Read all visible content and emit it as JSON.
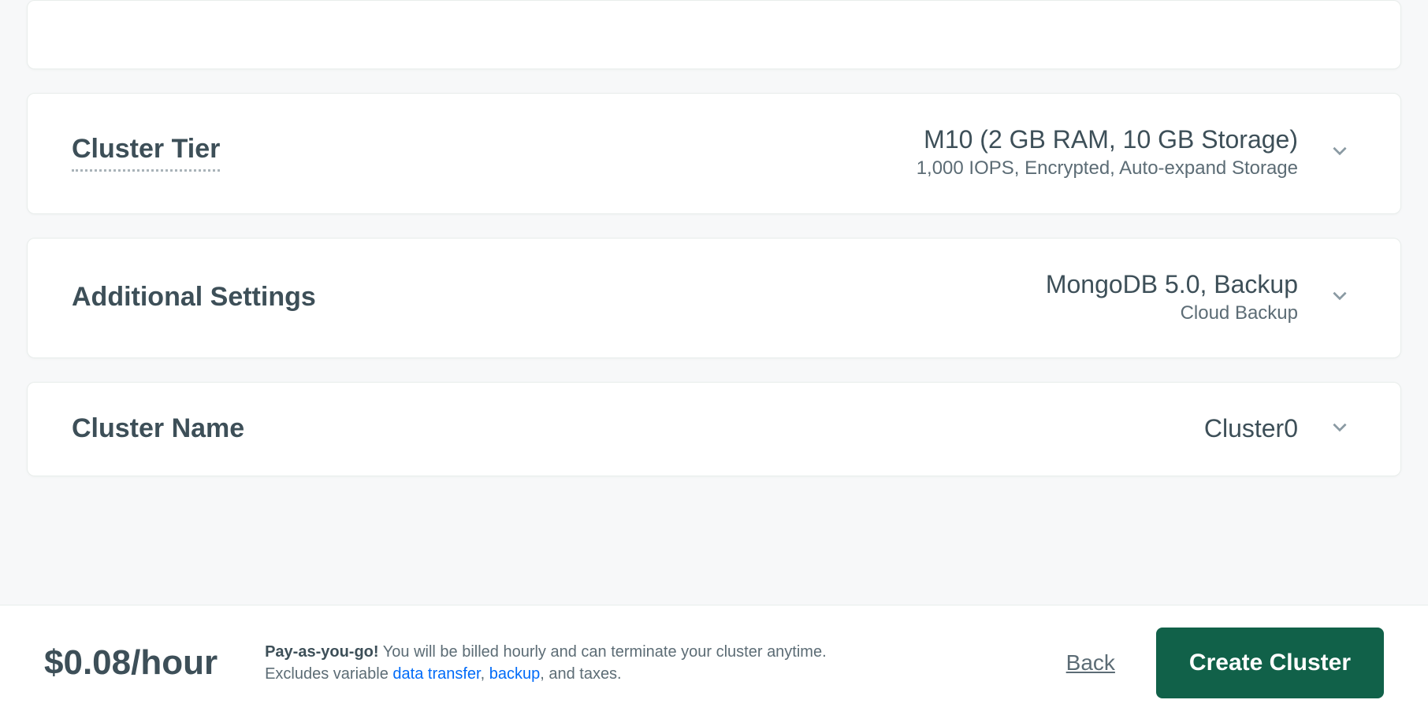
{
  "cards": {
    "tier": {
      "title": "Cluster Tier",
      "main": "M10 (2 GB RAM, 10 GB Storage)",
      "sub": "1,000 IOPS, Encrypted, Auto-expand Storage"
    },
    "additional": {
      "title": "Additional Settings",
      "main": "MongoDB 5.0, Backup",
      "sub": "Cloud Backup"
    },
    "name": {
      "title": "Cluster Name",
      "main": "Cluster0"
    }
  },
  "footer": {
    "price": "$0.08/hour",
    "blurb_bold": "Pay-as-you-go!",
    "blurb_1": " You will be billed hourly and can terminate your cluster anytime. Excludes variable ",
    "link1": "data transfer",
    "sep": ", ",
    "link2": "backup",
    "blurb_2": ", and taxes.",
    "back": "Back",
    "create": "Create Cluster"
  }
}
